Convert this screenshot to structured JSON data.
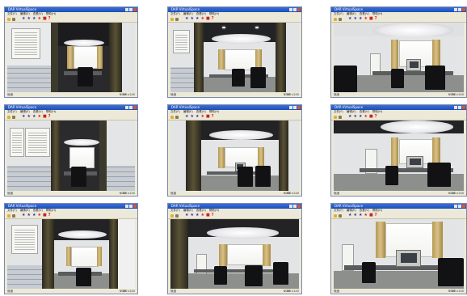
{
  "window": {
    "title": "DAR  VirtualSpace",
    "menu": [
      "文件(F)",
      "编辑(E)",
      "查看(V)",
      "帮助(H)"
    ],
    "status_left": "就绪",
    "status_num": "NUM",
    "status_res": "320×240"
  },
  "icons": {
    "toolbar": [
      "open-icon",
      "save-icon",
      "star-icon",
      "star-icon",
      "star-icon",
      "star-icon",
      "flag-icon",
      "help-icon"
    ]
  },
  "colors": {
    "titlebar": "#2a5cc9",
    "chrome": "#ece9d8",
    "toolbar_star_blue": "#2a2ad0",
    "toolbar_star_red": "#d02020"
  },
  "help_glyph": "?"
}
